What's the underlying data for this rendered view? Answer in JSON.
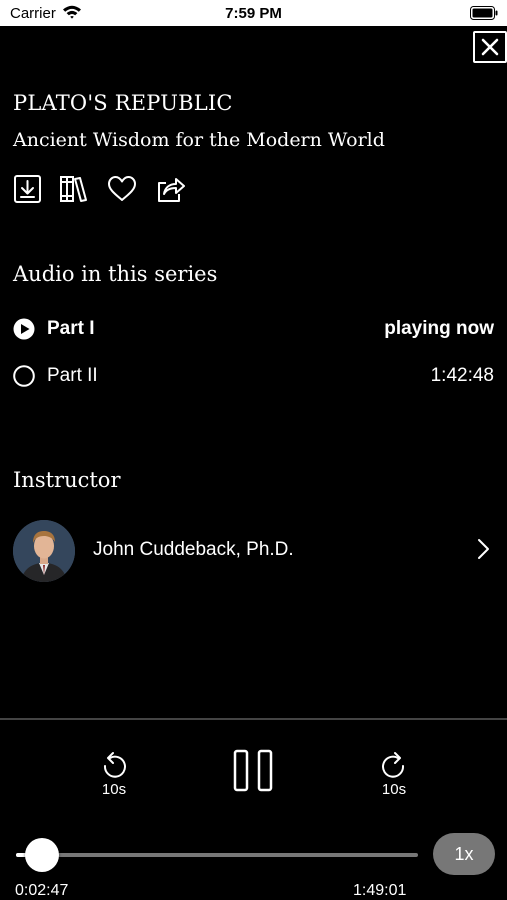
{
  "status_bar": {
    "carrier": "Carrier",
    "time": "7:59 PM",
    "icons": [
      "wifi-icon",
      "battery-icon"
    ]
  },
  "header": {
    "close_icon": "close-icon"
  },
  "course": {
    "title": "PLATO'S REPUBLIC",
    "subtitle": "Ancient Wisdom for the Modern World",
    "actions": [
      "download-icon",
      "library-icon",
      "heart-icon",
      "share-icon"
    ]
  },
  "series": {
    "heading": "Audio in this series",
    "episodes": [
      {
        "label": "Part I",
        "meta": "playing now",
        "state": "playing",
        "icon": "play-circle-icon"
      },
      {
        "label": "Part II",
        "meta": "1:42:48",
        "state": "unplayed",
        "icon": "empty-circle-icon"
      }
    ]
  },
  "instructor": {
    "heading": "Instructor",
    "name": "John Cuddeback, Ph.D.",
    "icons": [
      "avatar",
      "chevron-right-icon"
    ]
  },
  "player": {
    "rewind_label": "10s",
    "forward_label": "10s",
    "state": "playing",
    "speed": "1x",
    "elapsed": "0:02:47",
    "total": "1:49:01",
    "progress": 0.0255
  },
  "colors": {
    "background": "#000000",
    "text": "#ffffff",
    "status_bar": "#ffffff",
    "track": "#777777",
    "speed_pill": "#777777"
  }
}
